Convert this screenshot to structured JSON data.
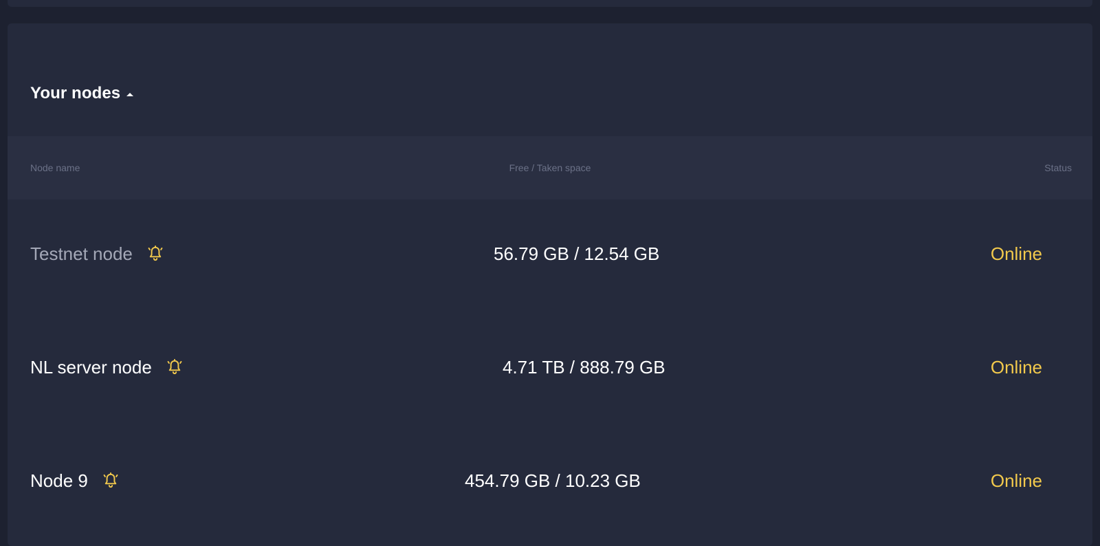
{
  "nodes_card": {
    "title": "Your nodes",
    "columns": {
      "name": "Node name",
      "space": "Free / Taken space",
      "status": "Status"
    },
    "rows": [
      {
        "name": "Testnet node",
        "space": "56.79 GB / 12.54 GB",
        "status": "Online",
        "icon": "bell-icon"
      },
      {
        "name": "NL server node",
        "space": "4.71 TB / 888.79 GB",
        "status": "Online",
        "icon": "bell-icon"
      },
      {
        "name": "Node 9",
        "space": "454.79 GB / 10.23 GB",
        "status": "Online",
        "icon": "bell-icon"
      }
    ]
  },
  "colors": {
    "page_background": "#1d2130",
    "card_background": "#252a3c",
    "table_header_background": "#2a2f42",
    "status_online": "#f2c94c",
    "bell_icon": "#f2c94c",
    "header_text": "#6b7187",
    "primary_text": "#ffffff"
  }
}
